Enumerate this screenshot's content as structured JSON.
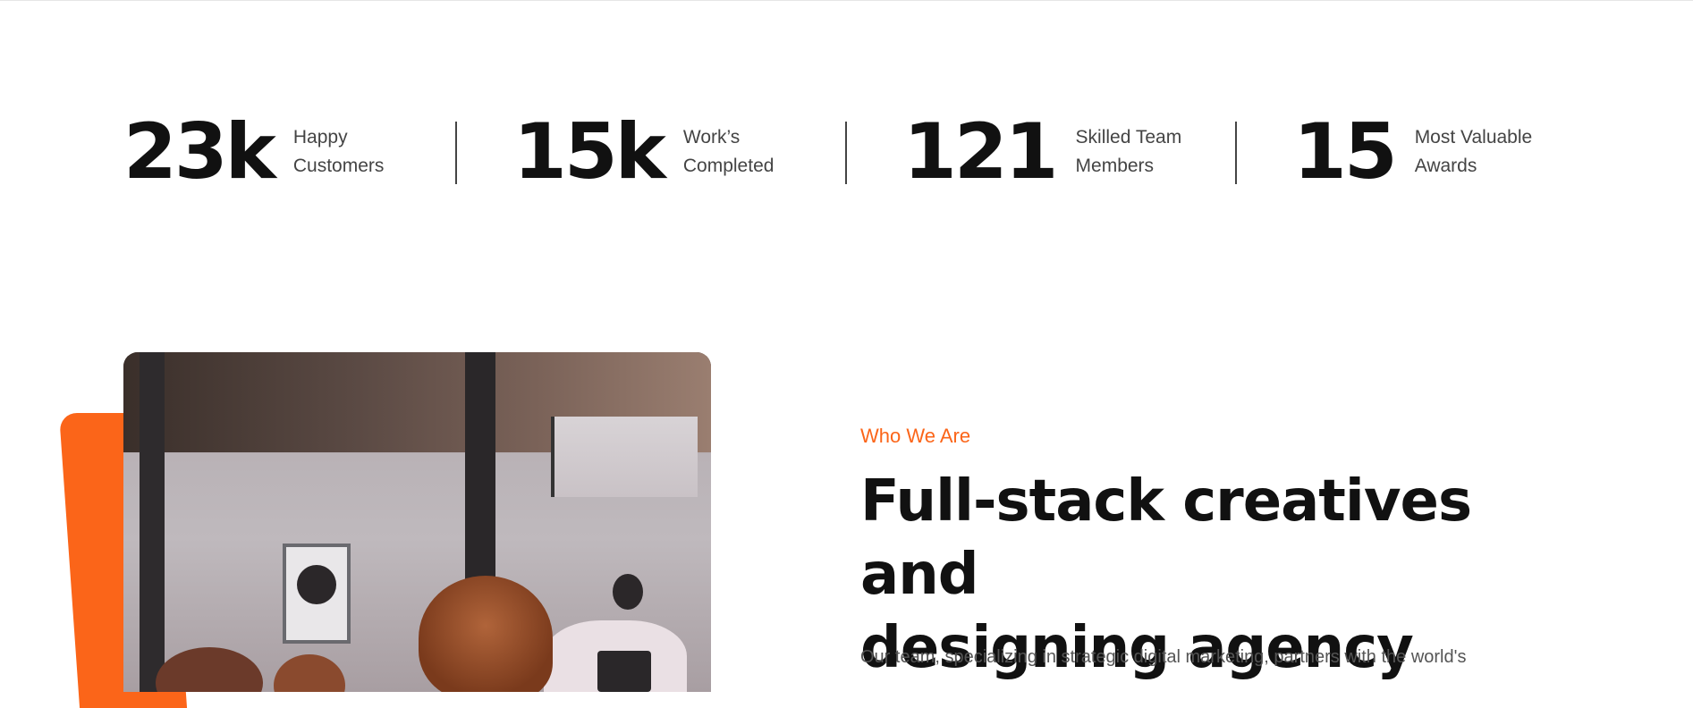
{
  "stats": [
    {
      "value": "23k",
      "label_line1": "Happy",
      "label_line2": "Customers"
    },
    {
      "value": "15k",
      "label_line1": "Work’s",
      "label_line2": "Completed"
    },
    {
      "value": "121",
      "label_line1": "Skilled Team",
      "label_line2": "Members"
    },
    {
      "value": "15",
      "label_line1": "Most Valuable",
      "label_line2": "Awards"
    }
  ],
  "about": {
    "eyebrow": "Who We Are",
    "heading_line1": "Full-stack creatives and",
    "heading_line2": "designing agency",
    "body": "Our team, specializing in strategic digital marketing, partners with the world's"
  },
  "colors": {
    "accent": "#fb6519",
    "heading": "#111111",
    "body": "#555555"
  }
}
